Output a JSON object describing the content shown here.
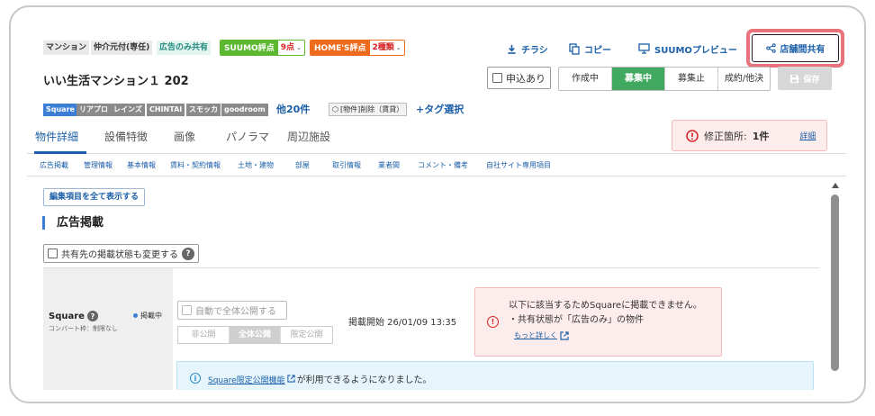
{
  "header": {
    "tags": [
      "マンション",
      "仲介元付(専任)",
      "広告のみ共有"
    ],
    "suumo_score": {
      "label": "SUUMO評点",
      "value": "9点"
    },
    "homes_score": {
      "label": "HOME'S評点",
      "value": "2種類"
    },
    "flyer_label": "チラシ",
    "copy_label": "コピー",
    "preview_label": "SUUMOプレビュー",
    "share_label": "店舗間共有"
  },
  "property": {
    "title": "いい生活マンション１ 202",
    "applied_label": "申込あり",
    "status_tabs": [
      "作成中",
      "募集中",
      "募集止",
      "成約/他決"
    ],
    "active_status": "募集中",
    "save_label": "保存"
  },
  "media_tags": [
    "Square",
    "リアプロ",
    "レインズ",
    "CHINTAI",
    "スモッカ",
    "goodroom"
  ],
  "more_tags": "他20件",
  "deleted_tag": "[物件]削除（賃貸）",
  "tag_select": "+タグ選択",
  "tabs": [
    "物件詳細",
    "設備特徴",
    "画像",
    "パノラマ",
    "周辺施設"
  ],
  "correction": {
    "label": "修正箇所:",
    "count": "1件",
    "link": "詳細"
  },
  "sub_nav": [
    "広告掲載",
    "管理情報",
    "基本情報",
    "賃料・契約情報",
    "土地・建物",
    "部屋",
    "取引情報",
    "業者間",
    "コメント・備考",
    "自社サイト専用項目"
  ],
  "content": {
    "show_all_label": "編集項目を全て表示する",
    "section_title": "広告掲載",
    "share_status_label": "共有先の掲載状態も変更する",
    "square": {
      "name": "Square",
      "sub": "コンバート枠：制限なし",
      "status": "掲載中",
      "auto_publish": "自動で全体公開する",
      "visibility_options": [
        "非公開",
        "全体公開",
        "限定公開"
      ],
      "active_visibility": "全体公開",
      "publish_start": "掲載開始 26/01/09 13:35"
    },
    "warning": {
      "line1": "以下に該当するためSquareに掲載できません。",
      "line2": "・共有状態が「広告のみ」の物件",
      "link": "もっと詳しく"
    },
    "info": {
      "link": "Square限定公開機能",
      "text": "が利用できるようになりました。"
    }
  }
}
